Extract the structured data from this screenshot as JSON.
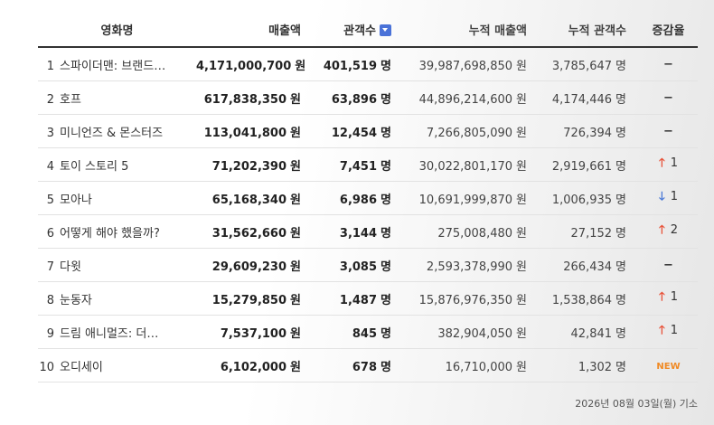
{
  "headers": {
    "title": "영화명",
    "revenue": "매출액",
    "audience": "관객수",
    "cum_revenue": "누적 매출액",
    "cum_audience": "누적 관객수",
    "change": "증감율"
  },
  "units": {
    "won": "원",
    "people": "명"
  },
  "rows": [
    {
      "rank": "1",
      "title": "스파이더맨: 브랜드…",
      "revenue": "4,171,000,700",
      "audience": "401,519",
      "cum_revenue": "39,987,698,850",
      "cum_audience": "3,785,647",
      "change_type": "same",
      "change_symbol": "−",
      "change_value": ""
    },
    {
      "rank": "2",
      "title": "호프",
      "revenue": "617,838,350",
      "audience": "63,896",
      "cum_revenue": "44,896,214,600",
      "cum_audience": "4,174,446",
      "change_type": "same",
      "change_symbol": "−",
      "change_value": ""
    },
    {
      "rank": "3",
      "title": "미니언즈 & 몬스터즈",
      "revenue": "113,041,800",
      "audience": "12,454",
      "cum_revenue": "7,266,805,090",
      "cum_audience": "726,394",
      "change_type": "same",
      "change_symbol": "−",
      "change_value": ""
    },
    {
      "rank": "4",
      "title": "토이 스토리 5",
      "revenue": "71,202,390",
      "audience": "7,451",
      "cum_revenue": "30,022,801,170",
      "cum_audience": "2,919,661",
      "change_type": "up",
      "change_symbol": "🡑",
      "change_value": "1"
    },
    {
      "rank": "5",
      "title": "모아나",
      "revenue": "65,168,340",
      "audience": "6,986",
      "cum_revenue": "10,691,999,870",
      "cum_audience": "1,006,935",
      "change_type": "down",
      "change_symbol": "🡓",
      "change_value": "1"
    },
    {
      "rank": "6",
      "title": "어떻게 해야 했을까?",
      "revenue": "31,562,660",
      "audience": "3,144",
      "cum_revenue": "275,008,480",
      "cum_audience": "27,152",
      "change_type": "up",
      "change_symbol": "🡑",
      "change_value": "2"
    },
    {
      "rank": "7",
      "title": "다윗",
      "revenue": "29,609,230",
      "audience": "3,085",
      "cum_revenue": "2,593,378,990",
      "cum_audience": "266,434",
      "change_type": "same",
      "change_symbol": "−",
      "change_value": ""
    },
    {
      "rank": "8",
      "title": "눈동자",
      "revenue": "15,279,850",
      "audience": "1,487",
      "cum_revenue": "15,876,976,350",
      "cum_audience": "1,538,864",
      "change_type": "up",
      "change_symbol": "🡑",
      "change_value": "1"
    },
    {
      "rank": "9",
      "title": "드림 애니멀즈: 더…",
      "revenue": "7,537,100",
      "audience": "845",
      "cum_revenue": "382,904,050",
      "cum_audience": "42,841",
      "change_type": "up",
      "change_symbol": "🡑",
      "change_value": "1"
    },
    {
      "rank": "10",
      "title": "오디세이",
      "revenue": "6,102,000",
      "audience": "678",
      "cum_revenue": "16,710,000",
      "cum_audience": "1,302",
      "change_type": "new",
      "change_symbol": "NEW",
      "change_value": ""
    }
  ],
  "footer": {
    "date": "2026년 08월 03일(월) 기소"
  },
  "colors": {
    "up": "#e8533a",
    "down": "#4a78d6",
    "new": "#f08a24",
    "sort_icon": "#4a72d8"
  }
}
